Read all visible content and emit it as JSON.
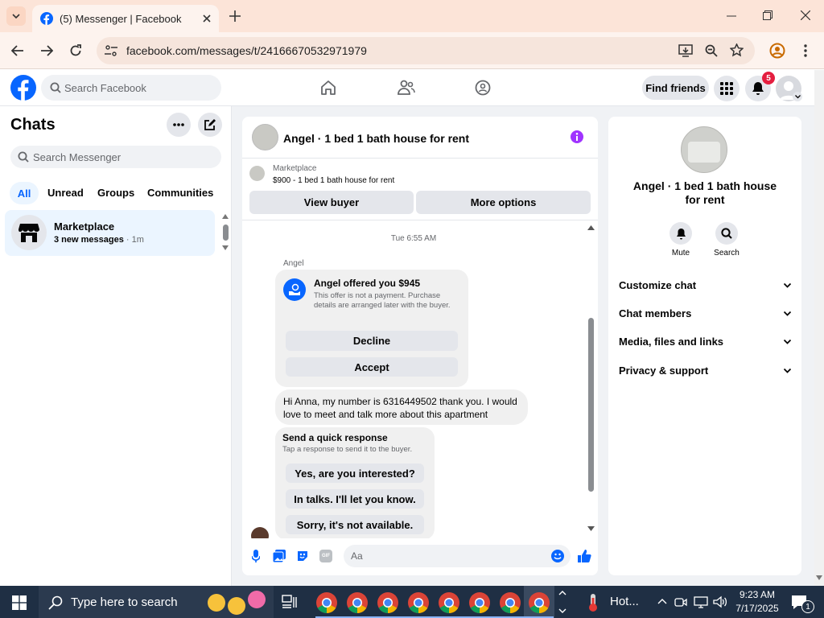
{
  "browser": {
    "tab_title": "(5) Messenger | Facebook",
    "url": "facebook.com/messages/t/24166670532971979"
  },
  "fb_header": {
    "search_placeholder": "Search Facebook",
    "find_friends": "Find friends",
    "notification_count": "5"
  },
  "chats": {
    "title": "Chats",
    "search_placeholder": "Search Messenger",
    "filters": [
      "All",
      "Unread",
      "Groups",
      "Communities"
    ],
    "active_filter": "All",
    "items": [
      {
        "name": "Marketplace",
        "preview": "3 new messages",
        "time": "1m"
      }
    ]
  },
  "conversation": {
    "title": "Angel · 1 bed 1 bath house for rent",
    "listing_source": "Marketplace",
    "listing_text": "$900 - 1 bed 1 bath house for rent",
    "view_buyer": "View buyer",
    "more_options": "More options",
    "timestamp": "Tue 6:55 AM",
    "sender": "Angel",
    "offer": {
      "title": "Angel offered you $945",
      "note": "This offer is not a payment. Purchase details are arranged later with the buyer.",
      "decline": "Decline",
      "accept": "Accept"
    },
    "message": "Hi Anna, my number is 6316449502 thank you. I would love to meet and talk more about this apartment",
    "quick_response": {
      "title": "Send a quick response",
      "subtitle": "Tap a response to send it to the buyer.",
      "options": [
        "Yes, are you interested?",
        "In talks. I'll let you know.",
        "Sorry, it's not available."
      ]
    },
    "composer_placeholder": "Aa"
  },
  "info_panel": {
    "title": "Angel · 1 bed 1 bath house for rent",
    "actions": [
      {
        "label": "Mute",
        "icon": "bell-icon"
      },
      {
        "label": "Search",
        "icon": "search-icon"
      }
    ],
    "sections": [
      "Customize chat",
      "Chat members",
      "Media, files and links",
      "Privacy & support"
    ]
  },
  "taskbar": {
    "search_placeholder": "Type here to search",
    "weather": "Hot...",
    "time": "9:23 AM",
    "date": "7/17/2025",
    "notification_count": "1"
  },
  "colors": {
    "fb_blue": "#0866ff",
    "accent_purple": "#a033ff",
    "notification_red": "#e41e3f",
    "chrome_tab_bg": "#fce4d8",
    "taskbar_bg": "#1f2f44"
  }
}
